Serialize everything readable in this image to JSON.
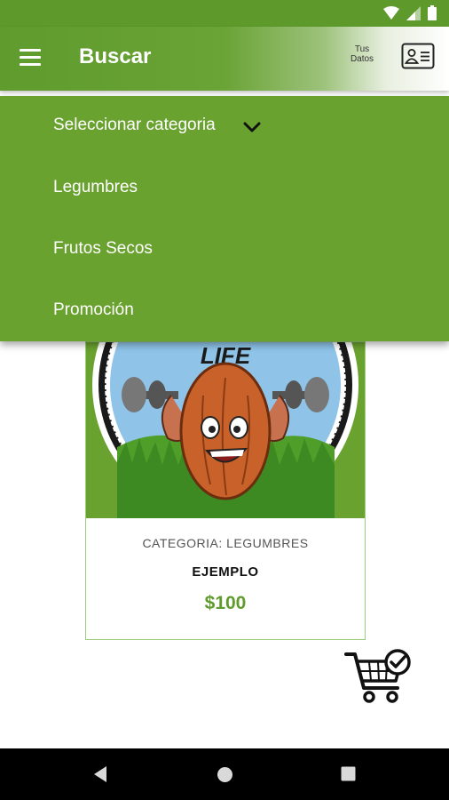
{
  "app_bar": {
    "title": "Buscar",
    "user_data_label_line1": "Tus",
    "user_data_label_line2": "Datos"
  },
  "category_dropdown": {
    "label": "Seleccionar categoria",
    "options": [
      "Legumbres",
      "Frutos Secos",
      "Promoción"
    ]
  },
  "product_card": {
    "category_text": "CATEGORIA: LEGUMBRES",
    "name": "EJEMPLO",
    "price": "$100",
    "logo_text": "LIFE"
  },
  "icons": {
    "menu": "hamburger-menu-icon",
    "user_data": "id-card-icon",
    "dropdown": "chevron-down-icon",
    "cart": "shopping-cart-check-icon",
    "nav_back": "back-triangle-icon",
    "nav_home": "home-circle-icon",
    "nav_recents": "recents-square-icon"
  },
  "colors": {
    "primary": "#6aa22f",
    "price": "#5f9b2d",
    "status_bar": "#5e9a2b"
  }
}
